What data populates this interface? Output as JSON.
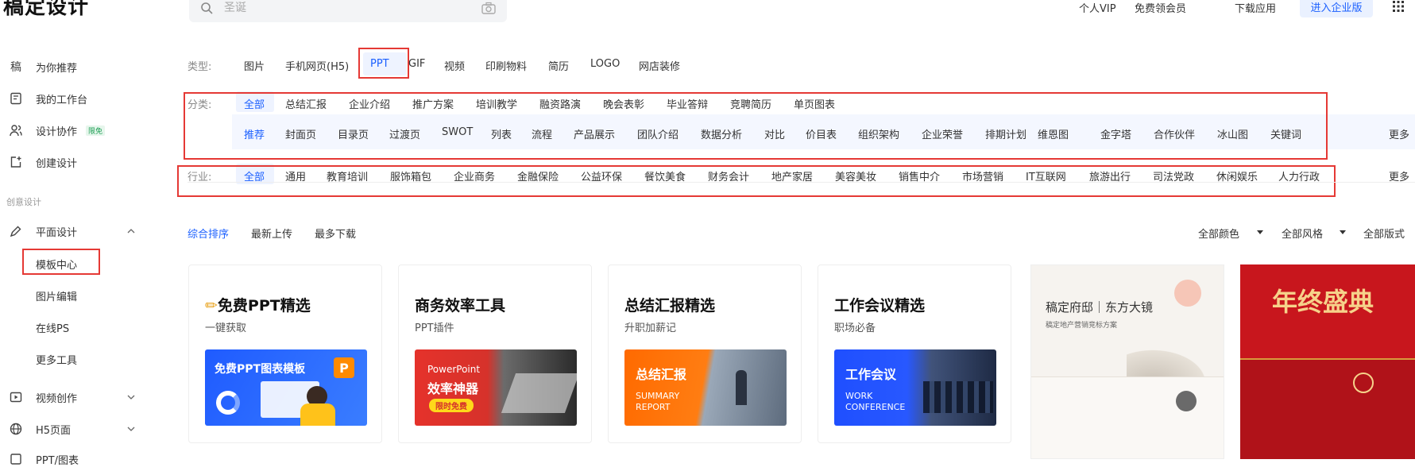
{
  "header": {
    "logo": "稿定设计",
    "search_placeholder": "圣诞",
    "links": [
      "个人VIP",
      "免费领会员",
      "下载应用"
    ],
    "enterprise_button": "进入企业版"
  },
  "sidebar": {
    "items": [
      {
        "label": "为你推荐",
        "icon": "gaoding-icon"
      },
      {
        "label": "我的工作台",
        "icon": "workspace-icon"
      },
      {
        "label": "设计协作",
        "icon": "team-icon",
        "badge": "限免"
      },
      {
        "label": "创建设计",
        "icon": "create-icon"
      }
    ],
    "section": "创意设计",
    "graphic": {
      "label": "平面设计",
      "icon": "pen-icon"
    },
    "graphic_sub": [
      "模板中心",
      "图片编辑",
      "在线PS",
      "更多工具"
    ],
    "video": {
      "label": "视频创作",
      "icon": "video-icon"
    },
    "h5": {
      "label": "H5页面",
      "icon": "globe-icon"
    },
    "ppt": {
      "label": "PPT/图表",
      "icon": "ppt-icon"
    }
  },
  "filters": {
    "type_label": "类型:",
    "types": [
      "图片",
      "手机网页(H5)",
      "PPT",
      "GIF",
      "视频",
      "印刷物料",
      "简历",
      "LOGO",
      "网店装修"
    ],
    "type_selected": "PPT",
    "category_label": "分类:",
    "categories": [
      "全部",
      "总结汇报",
      "企业介绍",
      "推广方案",
      "培训教学",
      "融资路演",
      "晚会表彰",
      "毕业答辩",
      "竞聘简历",
      "单页图表"
    ],
    "subcategories": [
      "推荐",
      "封面页",
      "目录页",
      "过渡页",
      "SWOT",
      "列表",
      "流程",
      "产品展示",
      "团队介绍",
      "数据分析",
      "对比",
      "价目表",
      "组织架构",
      "企业荣誉",
      "排期计划",
      "维恩图",
      "金字塔",
      "合作伙伴",
      "冰山图",
      "关键词"
    ],
    "more": "更多",
    "industry_label": "行业:",
    "industries": [
      "全部",
      "通用",
      "教育培训",
      "服饰箱包",
      "企业商务",
      "金融保险",
      "公益环保",
      "餐饮美食",
      "财务会计",
      "地产家居",
      "美容美妆",
      "销售中介",
      "市场营销",
      "IT互联网",
      "旅游出行",
      "司法党政",
      "休闲娱乐",
      "人力行政"
    ]
  },
  "sort": {
    "options": [
      "综合排序",
      "最新上传",
      "最多下载"
    ],
    "dropdowns": [
      "全部颜色",
      "全部风格",
      "全部版式"
    ]
  },
  "cards": [
    {
      "title": "免费PPT精选",
      "subtitle": "一键获取",
      "banner": "免费PPT图表模板"
    },
    {
      "title": "商务效率工具",
      "subtitle": "PPT插件",
      "banner_line1": "PowerPoint",
      "banner_line2": "效率神器",
      "banner_tag": "限时免费"
    },
    {
      "title": "总结汇报精选",
      "subtitle": "升职加薪记",
      "banner_line1": "总结汇报",
      "banner_line2": "SUMMARY",
      "banner_line3": "REPORT"
    },
    {
      "title": "工作会议精选",
      "subtitle": "职场必备",
      "banner_line1": "工作会议",
      "banner_line2": "WORK",
      "banner_line3": "CONFERENCE"
    }
  ],
  "thumbs": [
    {
      "title": "稿定府邸｜东方大镜",
      "subtitle": "稿定地产营销竞标方案"
    },
    {
      "title": "年终盛典"
    }
  ]
}
